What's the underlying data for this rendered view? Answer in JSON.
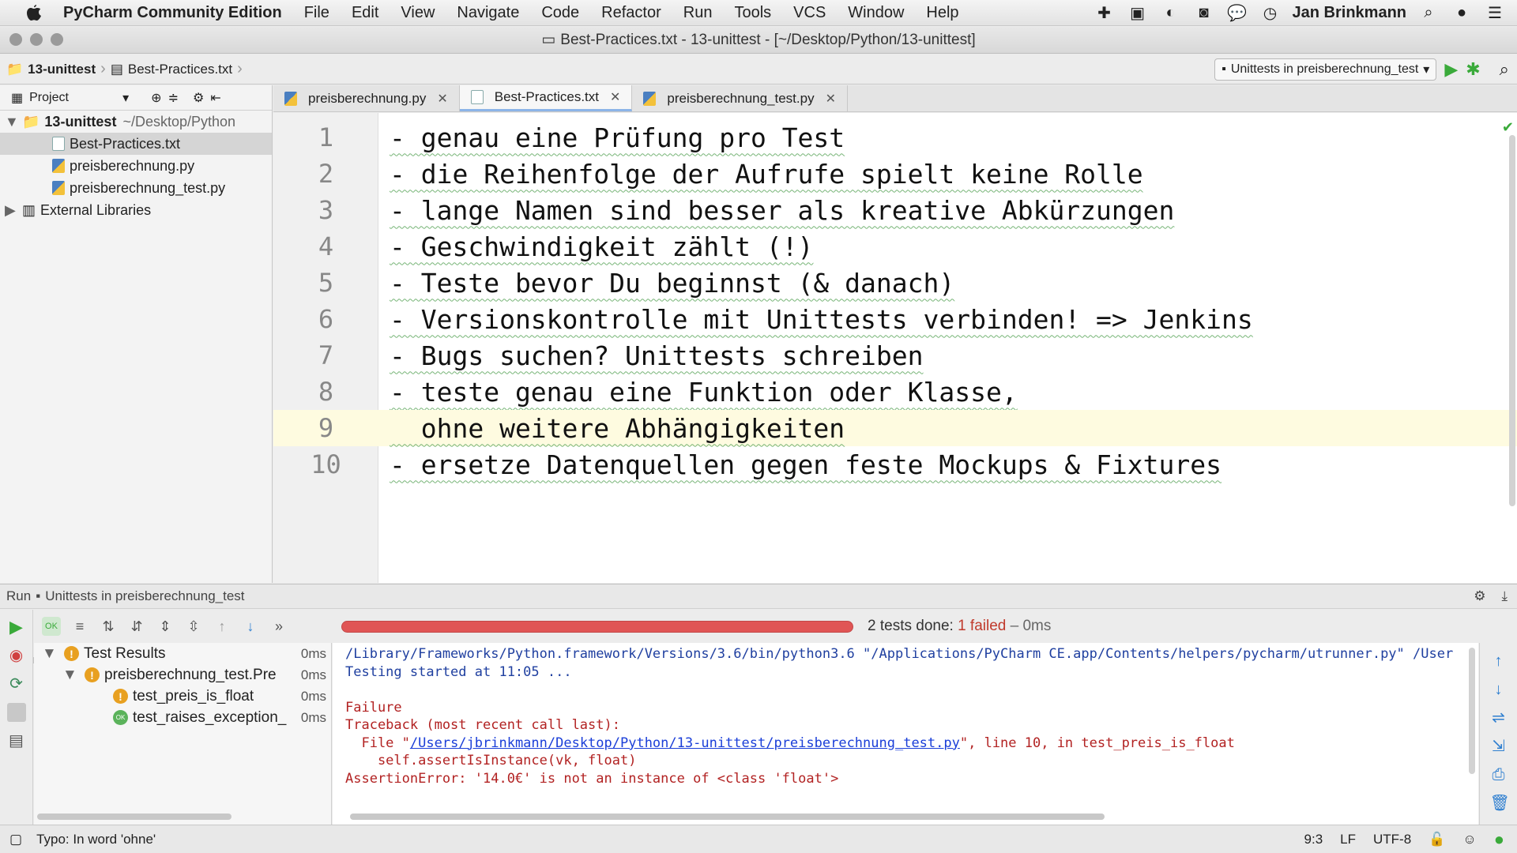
{
  "menubar": {
    "app_name": "PyCharm Community Edition",
    "items": [
      "File",
      "Edit",
      "View",
      "Navigate",
      "Code",
      "Refactor",
      "Run",
      "Tools",
      "VCS",
      "Window",
      "Help"
    ],
    "user": "Jan Brinkmann"
  },
  "window": {
    "title": "Best-Practices.txt - 13-unittest - [~/Desktop/Python/13-unittest]"
  },
  "navbar": {
    "crumb_project": "13-unittest",
    "crumb_file": "Best-Practices.txt",
    "run_config": "Unittests in preisberechnung_test"
  },
  "project": {
    "header": "Project",
    "root_name": "13-unittest",
    "root_path": "~/Desktop/Python",
    "files": [
      "Best-Practices.txt",
      "preisberechnung.py",
      "preisberechnung_test.py"
    ],
    "external": "External Libraries"
  },
  "tabs": [
    "preisberechnung.py",
    "Best-Practices.txt",
    "preisberechnung_test.py"
  ],
  "editor": {
    "lines": [
      {
        "n": "1",
        "text": "- genau eine Prüfung pro Test"
      },
      {
        "n": "2",
        "text": "- die Reihenfolge der Aufrufe spielt keine Rolle"
      },
      {
        "n": "3",
        "text": "- lange Namen sind besser als kreative Abkürzungen"
      },
      {
        "n": "4",
        "text": "- Geschwindigkeit zählt (!)"
      },
      {
        "n": "5",
        "text": "- Teste bevor Du beginnst (& danach)"
      },
      {
        "n": "6",
        "text": "- Versionskontrolle mit Unittests verbinden! => Jenkins"
      },
      {
        "n": "7",
        "text": "- Bugs suchen? Unittests schreiben"
      },
      {
        "n": "8",
        "text": "- teste genau eine Funktion oder Klasse,"
      },
      {
        "n": "9",
        "text": "  ohne weitere Abhängigkeiten"
      },
      {
        "n": "10",
        "text": "- ersetze Datenquellen gegen feste Mockups & Fixtures"
      }
    ]
  },
  "run": {
    "label": "Run",
    "config": "Unittests in preisberechnung_test",
    "status_done": "2 tests done: ",
    "status_failed": "1 failed",
    "status_time": " – 0ms",
    "progress_fraction": 1.0,
    "tree": {
      "root": "Test Results",
      "root_ms": "0ms",
      "suite": "preisberechnung_test.Pre",
      "suite_ms": "0ms",
      "t1": "test_preis_is_float",
      "t1_ms": "0ms",
      "t2": "test_raises_exception_",
      "t2_ms": "0ms"
    },
    "console": {
      "l1": "/Library/Frameworks/Python.framework/Versions/3.6/bin/python3.6 \"/Applications/PyCharm CE.app/Contents/helpers/pycharm/utrunner.py\" /User",
      "l2": "Testing started at 11:05 ...",
      "l3": "Failure",
      "l4": "Traceback (most recent call last):",
      "l5a": "  File \"",
      "l5link": "/Users/jbrinkmann/Desktop/Python/13-unittest/preisberechnung_test.py",
      "l5b": "\", line 10, in test_preis_is_float",
      "l6": "    self.assertIsInstance(vk, float)",
      "l7": "AssertionError: '14.0€' is not an instance of <class 'float'>"
    }
  },
  "statusbar": {
    "message": "Typo: In word 'ohne'",
    "position": "9:3",
    "line_sep": "LF",
    "encoding": "UTF-8"
  }
}
